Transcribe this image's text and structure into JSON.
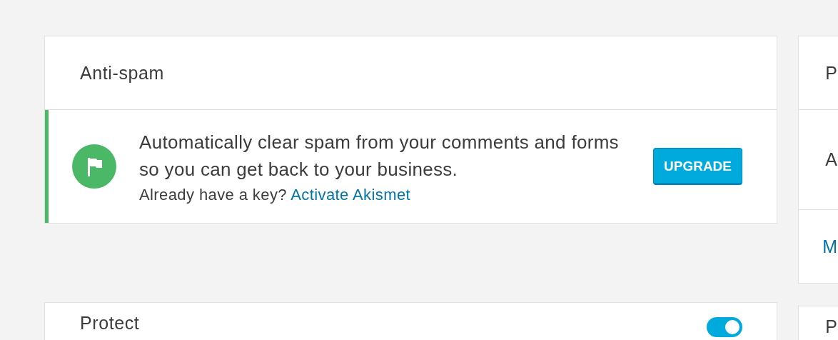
{
  "main_cards": [
    {
      "title": "Anti-spam",
      "notice": {
        "message": "Automatically clear spam from your comments and forms so you can get back to your business.",
        "prompt": "Already have a key?",
        "link": "Activate Akismet",
        "button": "UPGRADE"
      }
    },
    {
      "title": "Protect",
      "toggle": {
        "on": true
      }
    }
  ],
  "side_cards": [
    {
      "rows": [
        {
          "text": "P",
          "kind": "title"
        },
        {
          "text": "A",
          "kind": "text"
        },
        {
          "text": "M",
          "kind": "link"
        }
      ]
    },
    {
      "rows": [
        {
          "text": "P",
          "kind": "title"
        }
      ]
    }
  ]
}
